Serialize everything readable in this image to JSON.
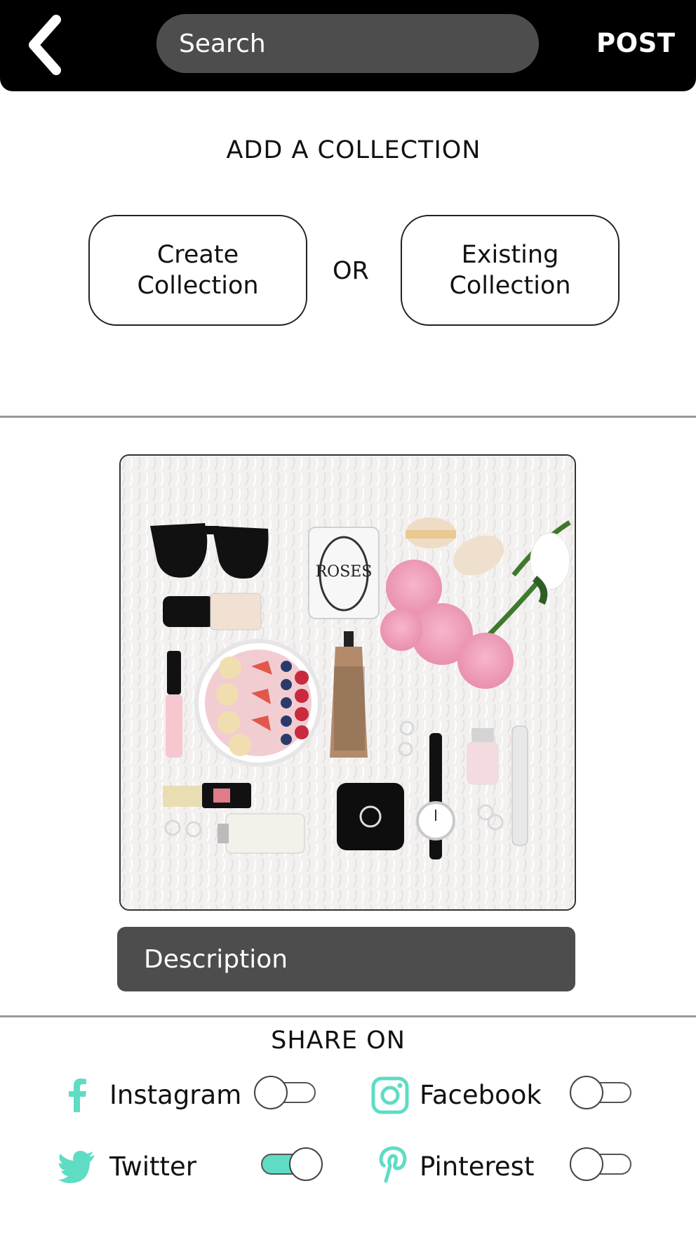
{
  "header": {
    "search_placeholder": "Search",
    "post_label": "POST"
  },
  "collection": {
    "title": "ADD A COLLECTION",
    "create_label": "Create Collection",
    "or_label": "OR",
    "existing_label": "Existing Collection"
  },
  "photo": {
    "candle_label": "ROSES"
  },
  "description": {
    "placeholder": "Description"
  },
  "share": {
    "title": "SHARE ON",
    "items": [
      {
        "label": "Instagram",
        "icon": "facebook-f-icon",
        "enabled": false
      },
      {
        "label": "Facebook",
        "icon": "instagram-icon",
        "enabled": false
      },
      {
        "label": "Twitter",
        "icon": "twitter-bird-icon",
        "enabled": true
      },
      {
        "label": "Pinterest",
        "icon": "pinterest-icon",
        "enabled": false
      }
    ]
  },
  "colors": {
    "header_bg": "#000000",
    "field_bg": "#4d4d4d",
    "accent": "#5fdcc4"
  }
}
